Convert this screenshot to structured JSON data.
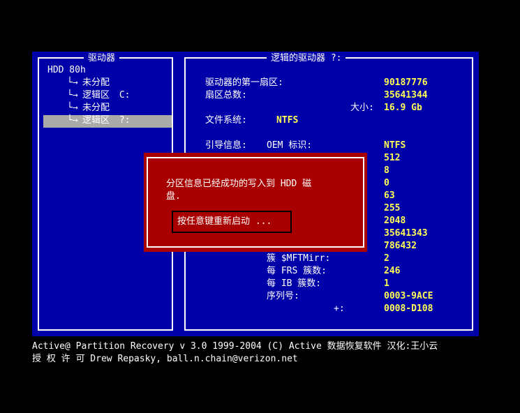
{
  "left_panel": {
    "title": "驱动器",
    "tree": [
      {
        "arrow": "",
        "label": "HDD 80h",
        "suffix": ""
      },
      {
        "arrow": "└→",
        "label": "未分配",
        "suffix": ""
      },
      {
        "arrow": "└→",
        "label": "逻辑区",
        "suffix": "C:"
      },
      {
        "arrow": "└→",
        "label": "未分配",
        "suffix": ""
      },
      {
        "arrow": "└→",
        "label": "逻辑区",
        "suffix": "?:"
      }
    ]
  },
  "right_panel": {
    "title": "逻辑的驱动器  ?:",
    "first_sector_label": "驱动器的第一扇区:",
    "first_sector_value": "90187776",
    "total_sectors_label": "扇区总数:",
    "total_sectors_value": "35641344",
    "size_label": "大小:",
    "size_value": "16.9 Gb",
    "fs_label": "文件系统:",
    "fs_value": "NTFS",
    "boot_label": "引导信息:",
    "oem_label": "OEM 标识:",
    "oem_value": "NTFS",
    "values": [
      "512",
      "8",
      "0",
      "63",
      "255",
      "2048",
      "35641343",
      "786432"
    ],
    "mftmirr_label": "簇      $MFTMirr:",
    "mftmirr_value": "2",
    "frs_label": "每 FRS 簇数:",
    "frs_value": "246",
    "ib_label": "每 IB 簇数:",
    "ib_value": "1",
    "serial_label": "序列号:",
    "serial_value": "0003-9ACE",
    "serial2_label": "+:",
    "serial2_value": "0008-D108"
  },
  "dialog": {
    "message_line1": "分区信息已经成功的写入到 HDD 磁",
    "message_line2": "盘.",
    "button_label": "按任意键重新启动 ..."
  },
  "footer": {
    "line1": "Active@ Partition Recovery v 3.0   1999-2004 (C) Active 数据恢复软件 汉化:王小云",
    "line2": "授 权 许 可 Drew Repasky, ball.n.chain@verizon.net"
  },
  "colors": {
    "background": "#000000",
    "panel": "#0000a8",
    "value": "#ffff55",
    "selection": "#aaaaaa",
    "dialog": "#a80000"
  }
}
